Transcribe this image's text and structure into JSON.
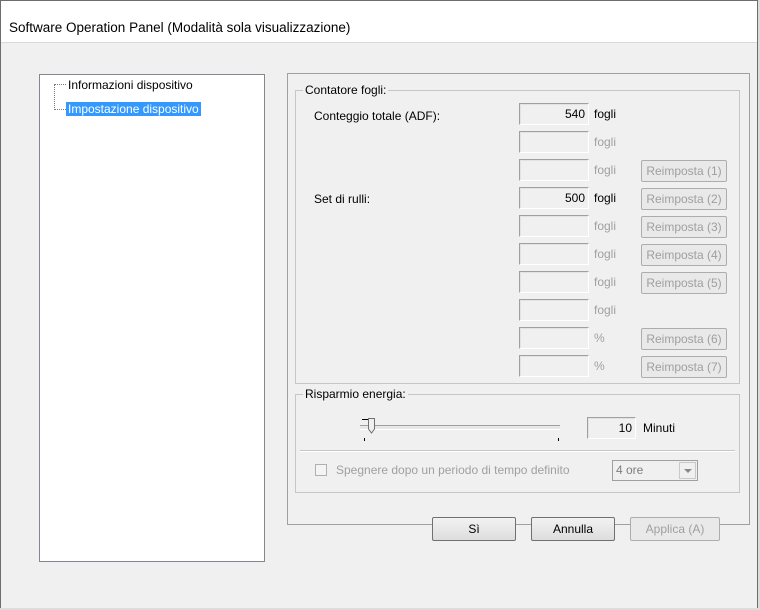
{
  "window": {
    "title": "Software Operation Panel (Modalità sola visualizzazione)"
  },
  "tree": {
    "items": [
      {
        "label": "Informazioni dispositivo",
        "selected": false
      },
      {
        "label": "Impostazione dispositivo",
        "selected": true
      }
    ]
  },
  "sheet_counter": {
    "title": "Contatore fogli:",
    "total_label": "Conteggio totale (ADF):",
    "rollers_label": "Set di rulli:",
    "rows": [
      {
        "value": "540",
        "unit": "fogli",
        "enabled": true,
        "button": ""
      },
      {
        "value": "",
        "unit": "fogli",
        "enabled": false,
        "button": ""
      },
      {
        "value": "",
        "unit": "fogli",
        "enabled": false,
        "button": "Reimposta (1)"
      },
      {
        "value": "500",
        "unit": "fogli",
        "enabled": true,
        "button": "Reimposta (2)"
      },
      {
        "value": "",
        "unit": "fogli",
        "enabled": false,
        "button": "Reimposta (3)"
      },
      {
        "value": "",
        "unit": "fogli",
        "enabled": false,
        "button": "Reimposta (4)"
      },
      {
        "value": "",
        "unit": "fogli",
        "enabled": false,
        "button": "Reimposta (5)"
      },
      {
        "value": "",
        "unit": "fogli",
        "enabled": false,
        "button": ""
      },
      {
        "value": "",
        "unit": "%",
        "enabled": false,
        "button": "Reimposta (6)"
      },
      {
        "value": "",
        "unit": "%",
        "enabled": false,
        "button": "Reimposta (7)"
      }
    ]
  },
  "power_saving": {
    "title": "Risparmio energia:",
    "value": "10",
    "unit": "Minuti",
    "checkbox_label": "Spegnere dopo un periodo di tempo definito",
    "checkbox_checked": false,
    "dropdown_value": "4 ore"
  },
  "buttons": {
    "ok": "Sì",
    "cancel": "Annulla",
    "apply": "Applica (A)"
  }
}
